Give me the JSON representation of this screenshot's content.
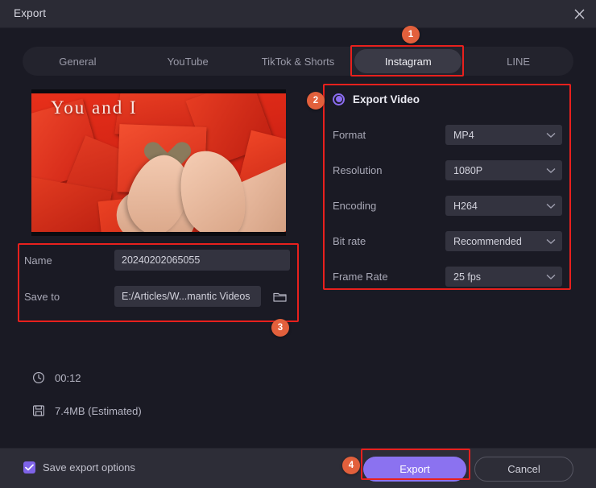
{
  "window": {
    "title": "Export",
    "close_icon": "close-icon"
  },
  "tabs": [
    {
      "label": "General",
      "active": false
    },
    {
      "label": "YouTube",
      "active": false
    },
    {
      "label": "TikTok & Shorts",
      "active": false
    },
    {
      "label": "Instagram",
      "active": true
    },
    {
      "label": "LINE",
      "active": false
    }
  ],
  "preview": {
    "overlay_title": "You and I"
  },
  "file_form": {
    "name_label": "Name",
    "name_value": "20240202065055",
    "saveto_label": "Save to",
    "saveto_value": "E:/Articles/W...mantic Videos",
    "folder_icon": "folder-icon"
  },
  "settings": {
    "export_video_label": "Export Video",
    "radio_selected": true,
    "rows": [
      {
        "label": "Format",
        "value": "MP4"
      },
      {
        "label": "Resolution",
        "value": "1080P"
      },
      {
        "label": "Encoding",
        "value": "H264"
      },
      {
        "label": "Bit rate",
        "value": "Recommended"
      },
      {
        "label": "Frame Rate",
        "value": "25  fps"
      }
    ]
  },
  "stats": [
    {
      "icon": "clock-icon",
      "text": "00:12"
    },
    {
      "icon": "save-disk-icon",
      "text": "7.4MB (Estimated)"
    }
  ],
  "footer": {
    "save_options_label": "Save export options",
    "save_options_checked": true,
    "export_label": "Export",
    "cancel_label": "Cancel"
  },
  "annotations": {
    "badges": [
      {
        "id": "1",
        "target": "instagram-tab"
      },
      {
        "id": "2",
        "target": "export-video-panel"
      },
      {
        "id": "3",
        "target": "file-form"
      },
      {
        "id": "4",
        "target": "export-button"
      }
    ],
    "highlight_color": "#e8201d",
    "badge_color": "#e2603c"
  },
  "theme": {
    "background": "#1a1a24",
    "titlebar": "#2b2b35",
    "footer": "#2d2d37",
    "field": "#33333f",
    "accent_purple": "#8b72f0",
    "tab_active": "#3a3a46"
  }
}
